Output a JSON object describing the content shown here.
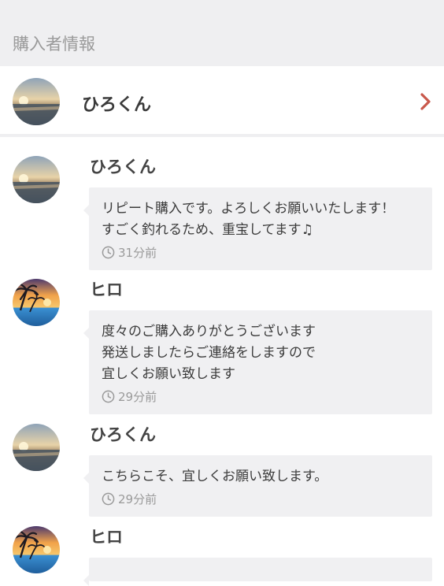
{
  "section": {
    "title": "購入者情報"
  },
  "buyer": {
    "name": "ひろくん",
    "avatar_icon": "sunset-sea-avatar-icon",
    "chevron_icon": "chevron-right-icon",
    "chevron_color": "#c9584b"
  },
  "messages": [
    {
      "sender": "ひろくん",
      "avatar_icon": "sunset-sea-avatar-icon",
      "text": "リピート購入です。よろしくお願いいたします！\nすごく釣れるため、重宝してます♫",
      "time": "31分前"
    },
    {
      "sender": "ヒロ",
      "avatar_icon": "palm-sunset-avatar-icon",
      "text": "度々のご購入ありがとうございます\n発送しましたらご連絡をしますので\n宜しくお願い致します",
      "time": "29分前"
    },
    {
      "sender": "ひろくん",
      "avatar_icon": "sunset-sea-avatar-icon",
      "text": "こちらこそ、宜しくお願い致します。",
      "time": "29分前"
    },
    {
      "sender": "ヒロ",
      "avatar_icon": "palm-sunset-avatar-icon",
      "text": "",
      "time": ""
    }
  ]
}
